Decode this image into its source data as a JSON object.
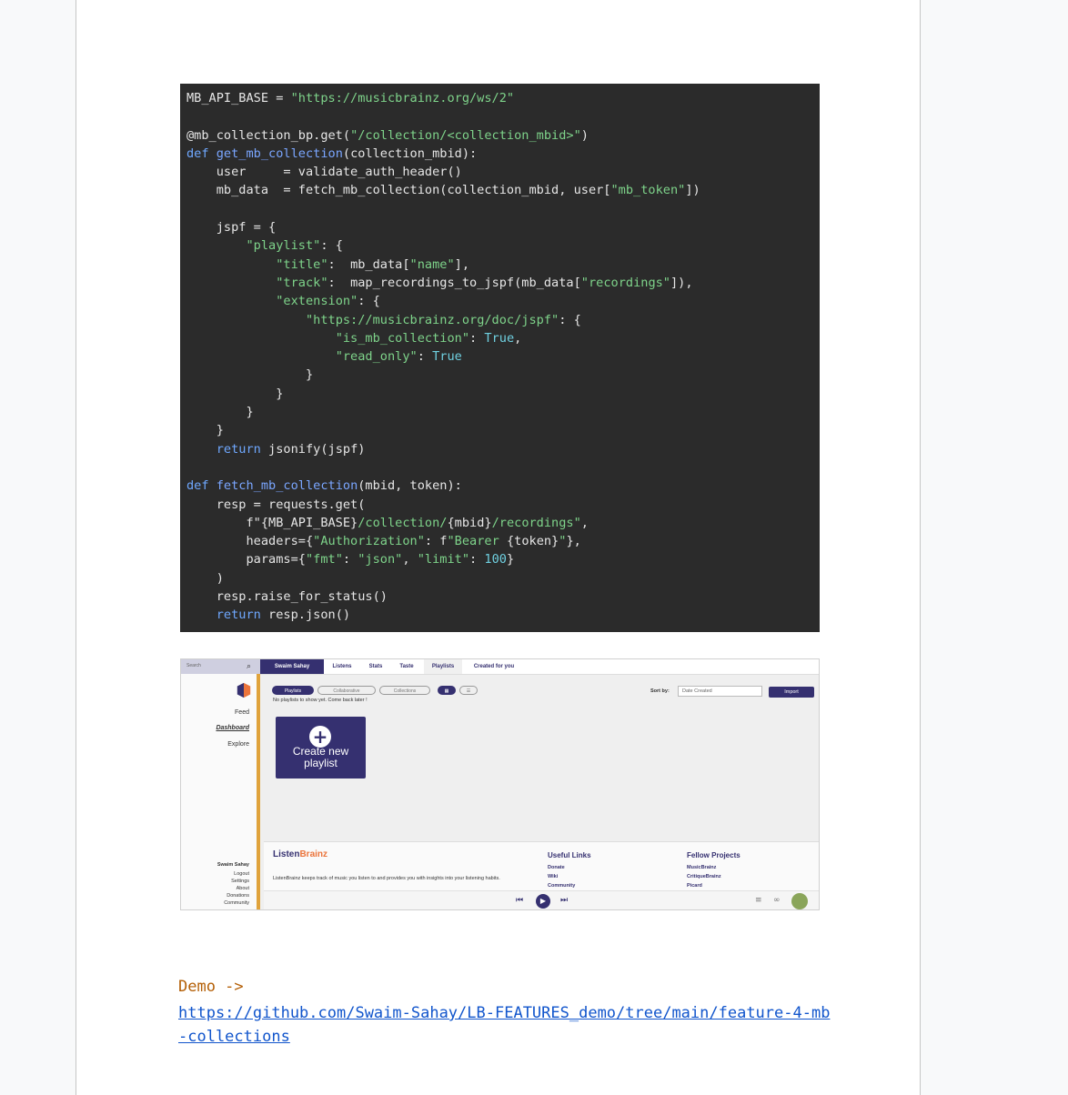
{
  "code": {
    "lines": [
      [
        {
          "t": "MB_API_BASE = ",
          "c": "d"
        },
        {
          "t": "\"https://musicbrainz.org/ws/2\"",
          "c": "s"
        }
      ],
      [],
      [
        {
          "t": "@mb_collection_bp.get(",
          "c": "d"
        },
        {
          "t": "\"/collection/<collection_mbid>\"",
          "c": "s"
        },
        {
          "t": ")",
          "c": "d"
        }
      ],
      [
        {
          "t": "def ",
          "c": "k"
        },
        {
          "t": "get_mb_collection",
          "c": "n"
        },
        {
          "t": "(collection_mbid):",
          "c": "d"
        }
      ],
      [
        {
          "t": "    user     = validate_auth_header()",
          "c": "d"
        }
      ],
      [
        {
          "t": "    mb_data  = fetch_mb_collection(collection_mbid, user[",
          "c": "d"
        },
        {
          "t": "\"mb_token\"",
          "c": "s"
        },
        {
          "t": "])",
          "c": "d"
        }
      ],
      [],
      [
        {
          "t": "    jspf = {",
          "c": "d"
        }
      ],
      [
        {
          "t": "        ",
          "c": "d"
        },
        {
          "t": "\"playlist\"",
          "c": "s"
        },
        {
          "t": ": {",
          "c": "d"
        }
      ],
      [
        {
          "t": "            ",
          "c": "d"
        },
        {
          "t": "\"title\"",
          "c": "s"
        },
        {
          "t": ":  mb_data[",
          "c": "d"
        },
        {
          "t": "\"name\"",
          "c": "s"
        },
        {
          "t": "],",
          "c": "d"
        }
      ],
      [
        {
          "t": "            ",
          "c": "d"
        },
        {
          "t": "\"track\"",
          "c": "s"
        },
        {
          "t": ":  map_recordings_to_jspf(mb_data[",
          "c": "d"
        },
        {
          "t": "\"recordings\"",
          "c": "s"
        },
        {
          "t": "]),",
          "c": "d"
        }
      ],
      [
        {
          "t": "            ",
          "c": "d"
        },
        {
          "t": "\"extension\"",
          "c": "s"
        },
        {
          "t": ": {",
          "c": "d"
        }
      ],
      [
        {
          "t": "                ",
          "c": "d"
        },
        {
          "t": "\"https://musicbrainz.org/doc/jspf\"",
          "c": "s"
        },
        {
          "t": ": {",
          "c": "d"
        }
      ],
      [
        {
          "t": "                    ",
          "c": "d"
        },
        {
          "t": "\"is_mb_collection\"",
          "c": "s"
        },
        {
          "t": ": ",
          "c": "d"
        },
        {
          "t": "True",
          "c": "b"
        },
        {
          "t": ",",
          "c": "d"
        }
      ],
      [
        {
          "t": "                    ",
          "c": "d"
        },
        {
          "t": "\"read_only\"",
          "c": "s"
        },
        {
          "t": ": ",
          "c": "d"
        },
        {
          "t": "True",
          "c": "b"
        }
      ],
      [
        {
          "t": "                }",
          "c": "d"
        }
      ],
      [
        {
          "t": "            }",
          "c": "d"
        }
      ],
      [
        {
          "t": "        }",
          "c": "d"
        }
      ],
      [
        {
          "t": "    }",
          "c": "d"
        }
      ],
      [
        {
          "t": "    ",
          "c": "d"
        },
        {
          "t": "return",
          "c": "k"
        },
        {
          "t": " jsonify(jspf)",
          "c": "d"
        }
      ],
      [],
      [
        {
          "t": "def ",
          "c": "k"
        },
        {
          "t": "fetch_mb_collection",
          "c": "n"
        },
        {
          "t": "(mbid, token):",
          "c": "d"
        }
      ],
      [
        {
          "t": "    resp = requests.get(",
          "c": "d"
        }
      ],
      [
        {
          "t": "        f\"{MB_API_BASE}",
          "c": "d"
        },
        {
          "t": "/collection/",
          "c": "s"
        },
        {
          "t": "{mbid}",
          "c": "d"
        },
        {
          "t": "/recordings\"",
          "c": "s"
        },
        {
          "t": ",",
          "c": "d"
        }
      ],
      [
        {
          "t": "        headers={",
          "c": "d"
        },
        {
          "t": "\"Authorization\"",
          "c": "s"
        },
        {
          "t": ": f",
          "c": "d"
        },
        {
          "t": "\"Bearer ",
          "c": "s"
        },
        {
          "t": "{token}",
          "c": "d"
        },
        {
          "t": "\"",
          "c": "s"
        },
        {
          "t": "},",
          "c": "d"
        }
      ],
      [
        {
          "t": "        params={",
          "c": "d"
        },
        {
          "t": "\"fmt\"",
          "c": "s"
        },
        {
          "t": ": ",
          "c": "d"
        },
        {
          "t": "\"json\"",
          "c": "s"
        },
        {
          "t": ", ",
          "c": "d"
        },
        {
          "t": "\"limit\"",
          "c": "s"
        },
        {
          "t": ": ",
          "c": "d"
        },
        {
          "t": "100",
          "c": "b"
        },
        {
          "t": "}",
          "c": "d"
        }
      ],
      [
        {
          "t": "    )",
          "c": "d"
        }
      ],
      [
        {
          "t": "    resp.raise_for_status()",
          "c": "d"
        }
      ],
      [
        {
          "t": "    ",
          "c": "d"
        },
        {
          "t": "return",
          "c": "k"
        },
        {
          "t": " resp.json()",
          "c": "d"
        }
      ]
    ]
  },
  "screenshot": {
    "search_placeholder": "Search",
    "tabs": [
      "Swaim Sahay",
      "Listens",
      "Stats",
      "Taste",
      "Playlists",
      "Created for you"
    ],
    "nav": [
      "Feed",
      "Dashboard",
      "Explore"
    ],
    "pills": [
      "Playlists",
      "Collaborative",
      "Collections"
    ],
    "empty_text": "No playlists to show yet. Come back later !",
    "sort_label": "Sort by:",
    "sort_value": "Date Created",
    "import_label": "Import",
    "create_card": "Create new playlist",
    "footer_brand_a": "Listen",
    "footer_brand_b": "Brainz",
    "footer_desc": "ListenBrainz keeps track of music you listen to and provides you with insights into your listening habits.",
    "useful_links_title": "Useful Links",
    "useful_links": [
      "Donate",
      "Wiki",
      "Community"
    ],
    "fellow_title": "Fellow Projects",
    "fellow": [
      "MusicBrainz",
      "CritiqueBrainz",
      "Picard"
    ],
    "user_links": [
      "Swaim Sahay",
      "Logout",
      "Settings",
      "About",
      "Donations",
      "Community"
    ]
  },
  "demo": {
    "label": "Demo ->",
    "url": "https://github.com/Swaim-Sahay/LB-FEATURES_demo/tree/main/feature-4-mb-collections"
  }
}
